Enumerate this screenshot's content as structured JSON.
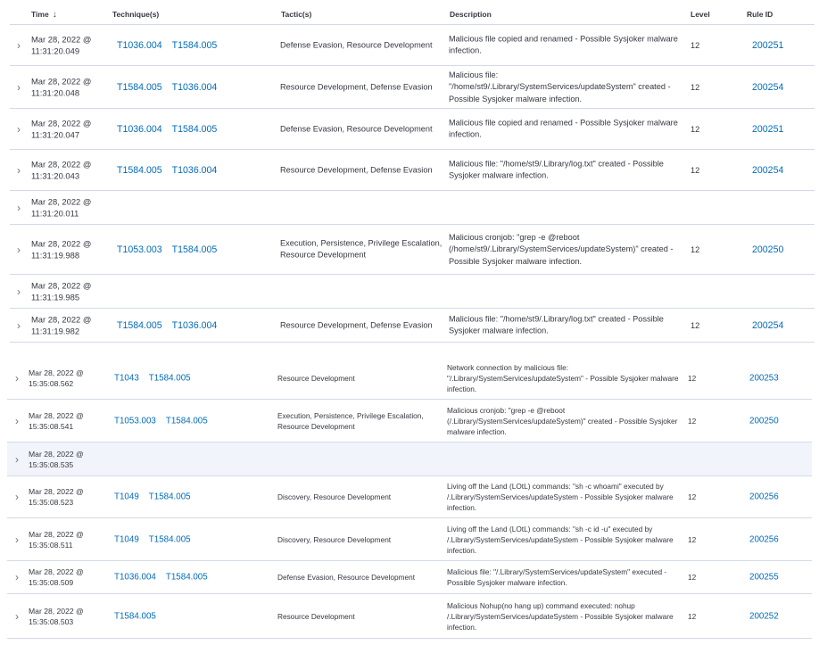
{
  "table_a": {
    "headers": {
      "time": "Time",
      "techniques": "Technique(s)",
      "tactics": "Tactic(s)",
      "description": "Description",
      "level": "Level",
      "rule_id": "Rule ID"
    },
    "sort_icon": "arrow-down-icon",
    "rows": [
      {
        "date": "Mar 28, 2022 @",
        "time": "11:31:20.049",
        "techniques": [
          "T1036.004",
          "T1584.005"
        ],
        "tactics": "Defense Evasion, Resource Development",
        "description": "Malicious file copied and renamed - Possible Sysjoker malware infection.",
        "level": "12",
        "rule_id": "200251"
      },
      {
        "date": "Mar 28, 2022 @",
        "time": "11:31:20.048",
        "techniques": [
          "T1584.005",
          "T1036.004"
        ],
        "tactics": "Resource Development, Defense Evasion",
        "description": "Malicious file: \"/home/st9/.Library/SystemServices/updateSystem\" created - Possible Sysjoker malware infection.",
        "level": "12",
        "rule_id": "200254"
      },
      {
        "date": "Mar 28, 2022 @",
        "time": "11:31:20.047",
        "techniques": [
          "T1036.004",
          "T1584.005"
        ],
        "tactics": "Defense Evasion, Resource Development",
        "description": "Malicious file copied and renamed - Possible Sysjoker malware infection.",
        "level": "12",
        "rule_id": "200251"
      },
      {
        "date": "Mar 28, 2022 @",
        "time": "11:31:20.043",
        "techniques": [
          "T1584.005",
          "T1036.004"
        ],
        "tactics": "Resource Development, Defense Evasion",
        "description": "Malicious file: \"/home/st9/.Library/log.txt\" created - Possible Sysjoker malware infection.",
        "level": "12",
        "rule_id": "200254"
      },
      {
        "date": "Mar 28, 2022 @",
        "time": "11:31:20.011",
        "techniques": [],
        "tactics": "",
        "description": "",
        "level": "",
        "rule_id": ""
      },
      {
        "date": "Mar 28, 2022 @",
        "time": "11:31:19.988",
        "techniques": [
          "T1053.003",
          "T1584.005"
        ],
        "tactics": "Execution, Persistence, Privilege Escalation, Resource Development",
        "description": "Malicious cronjob: \"grep -e @reboot (/home/st9/.Library/SystemServices/updateSystem)\" created - Possible Sysjoker malware infection.",
        "level": "12",
        "rule_id": "200250"
      },
      {
        "date": "Mar 28, 2022 @",
        "time": "11:31:19.985",
        "techniques": [],
        "tactics": "",
        "description": "",
        "level": "",
        "rule_id": ""
      },
      {
        "date": "Mar 28, 2022 @",
        "time": "11:31:19.982",
        "techniques": [
          "T1584.005",
          "T1036.004"
        ],
        "tactics": "Resource Development, Defense Evasion",
        "description": "Malicious file: \"/home/st9/.Library/log.txt\" created - Possible Sysjoker malware infection.",
        "level": "12",
        "rule_id": "200254"
      }
    ]
  },
  "table_b": {
    "rows": [
      {
        "date": "Mar 28, 2022 @",
        "time": "15:35:08.562",
        "techniques": [
          "T1043",
          "T1584.005"
        ],
        "tactics": "Resource Development",
        "description": "Network connection by malicious file: \"/.Library/SystemServices/updateSystem\" - Possible Sysjoker malware infection.",
        "level": "12",
        "rule_id": "200253",
        "highlight": false
      },
      {
        "date": "Mar 28, 2022 @",
        "time": "15:35:08.541",
        "techniques": [
          "T1053.003",
          "T1584.005"
        ],
        "tactics": "Execution, Persistence, Privilege Escalation, Resource Development",
        "description": "Malicious cronjob: \"grep -e @reboot (/.Library/SystemServices/updateSystem)\" created - Possible Sysjoker malware infection.",
        "level": "12",
        "rule_id": "200250",
        "highlight": false
      },
      {
        "date": "Mar 28, 2022 @",
        "time": "15:35:08.535",
        "techniques": [],
        "tactics": "",
        "description": "",
        "level": "",
        "rule_id": "",
        "highlight": true
      },
      {
        "date": "Mar 28, 2022 @",
        "time": "15:35:08.523",
        "techniques": [
          "T1049",
          "T1584.005"
        ],
        "tactics": "Discovery, Resource Development",
        "description": "Living off the Land (LOtL) commands: \"sh -c whoami\" executed by /.Library/SystemServices/updateSystem - Possible Sysjoker malware infection.",
        "level": "12",
        "rule_id": "200256",
        "highlight": false
      },
      {
        "date": "Mar 28, 2022 @",
        "time": "15:35:08.511",
        "techniques": [
          "T1049",
          "T1584.005"
        ],
        "tactics": "Discovery, Resource Development",
        "description": "Living off the Land (LOtL) commands: \"sh -c id -u\" executed by /.Library/SystemServices/updateSystem - Possible Sysjoker malware infection.",
        "level": "12",
        "rule_id": "200256",
        "highlight": false
      },
      {
        "date": "Mar 28, 2022 @",
        "time": "15:35:08.509",
        "techniques": [
          "T1036.004",
          "T1584.005"
        ],
        "tactics": "Defense Evasion, Resource Development",
        "description": "Malicious file: \"/.Library/SystemServices/updateSystem\" executed - Possible Sysjoker malware infection.",
        "level": "12",
        "rule_id": "200255",
        "highlight": false
      },
      {
        "date": "Mar 28, 2022 @",
        "time": "15:35:08.503",
        "techniques": [
          "T1584.005"
        ],
        "tactics": "Resource Development",
        "description": "Malicious Nohup(no hang up) command executed: nohup /.Library/SystemServices/updateSystem - Possible Sysjoker malware infection.",
        "level": "12",
        "rule_id": "200252",
        "highlight": false
      }
    ]
  },
  "icons": {
    "expand_row": "chevron-right-icon"
  }
}
